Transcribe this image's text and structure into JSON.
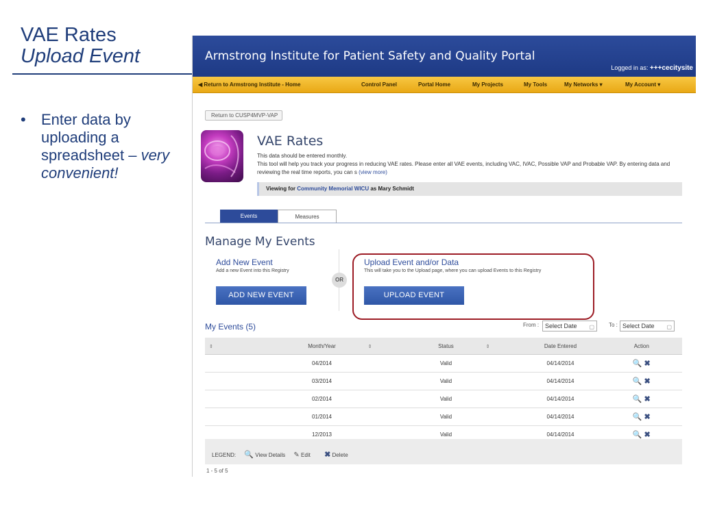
{
  "slide": {
    "title": "VAE Rates",
    "subtitle": "Upload Event",
    "bullet_main": "Enter data by uploading a spreadsheet –",
    "bullet_em": "very convenient!",
    "bullet_char": "•"
  },
  "portal": {
    "title": "Armstrong Institute for Patient Safety and Quality Portal",
    "logged_prefix": "Logged in as:",
    "logged_user": "+++cecitysite"
  },
  "nav": {
    "back": "◀ Return to Armstrong Institute - Home",
    "items": [
      "Control Panel",
      "Portal Home",
      "My Projects",
      "My Tools",
      "My Networks ▾",
      "My Account ▾"
    ]
  },
  "breadcrumb": "Return to CUSP4MVP-VAP",
  "page": {
    "heading": "VAE Rates",
    "desc_line1": "This data should be entered monthly.",
    "desc_line2": "This tool will help you track your progress in reducing VAE rates. Please enter all VAE events, including VAC, IVAC, Possible VAP and Probable VAP. By entering data and reviewing the real time reports, you can s",
    "desc_more": "(view more)",
    "viewing_prefix": "Viewing  for",
    "viewing_unit": "Community Memorial WICU",
    "viewing_suffix": "as Mary Schmidt"
  },
  "tabs": [
    "Events",
    "Measures"
  ],
  "manage": {
    "heading": "Manage My Events",
    "add_title": "Add New Event",
    "add_desc": "Add a new Event into this Registry",
    "add_button": "ADD NEW EVENT",
    "or": "OR",
    "upload_title": "Upload Event and/or Data",
    "upload_desc": "This will take you to the Upload page, where you can upload Events to this Registry",
    "upload_button": "UPLOAD EVENT"
  },
  "events": {
    "title": "My Events (5)",
    "from_label": "From :",
    "to_label": "To :",
    "date_placeholder": "Select Date",
    "columns": [
      "Month/Year",
      "Status",
      "Date Entered",
      "Action"
    ],
    "sort_glyph": "⇕",
    "rows": [
      {
        "month": "04/2014",
        "status": "Valid",
        "entered": "04/14/2014"
      },
      {
        "month": "03/2014",
        "status": "Valid",
        "entered": "04/14/2014"
      },
      {
        "month": "02/2014",
        "status": "Valid",
        "entered": "04/14/2014"
      },
      {
        "month": "01/2014",
        "status": "Valid",
        "entered": "04/14/2014"
      },
      {
        "month": "12/2013",
        "status": "Valid",
        "entered": "04/14/2014"
      }
    ],
    "view_glyph": "🔍",
    "delete_glyph": "✖"
  },
  "legend": {
    "label": "LEGEND:",
    "view": "View Details",
    "edit": "Edit",
    "delete": "Delete",
    "edit_glyph": "✎"
  },
  "pager": "1 - 5 of 5",
  "colors": {
    "accent": "#2d4b9a",
    "header": "#1e3a85",
    "navbar": "#f0b72c",
    "highlight_frame": "#9c1b24"
  }
}
